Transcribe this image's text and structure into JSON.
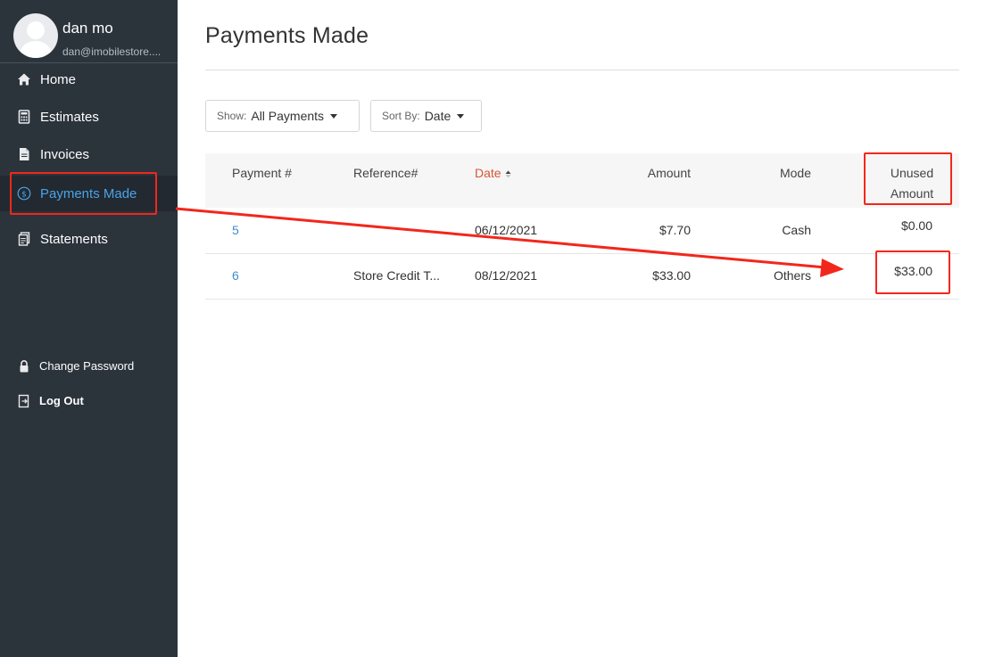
{
  "profile": {
    "name": "dan mo",
    "email": "dan@imobilestore...."
  },
  "nav": {
    "items": [
      {
        "label": "Home",
        "icon": "home-icon"
      },
      {
        "label": "Estimates",
        "icon": "calculator-icon"
      },
      {
        "label": "Invoices",
        "icon": "document-icon"
      },
      {
        "label": "Payments Made",
        "icon": "dollar-circle-icon",
        "active": true
      },
      {
        "label": "Statements",
        "icon": "statements-icon"
      }
    ],
    "secondary": [
      {
        "label": "Change Password",
        "icon": "lock-icon"
      },
      {
        "label": "Log Out",
        "icon": "logout-icon"
      }
    ]
  },
  "page": {
    "title": "Payments Made"
  },
  "filters": {
    "show": {
      "label": "Show:",
      "value": "All Payments"
    },
    "sort": {
      "label": "Sort By:",
      "value": "Date"
    }
  },
  "table": {
    "headers": {
      "payment": "Payment #",
      "reference": "Reference#",
      "date": "Date",
      "amount": "Amount",
      "mode": "Mode",
      "unused_line1": "Unused",
      "unused_line2": "Amount"
    },
    "sorted_column": "Date",
    "rows": [
      {
        "payment": "5",
        "reference": "",
        "date": "06/12/2021",
        "amount": "$7.70",
        "mode": "Cash",
        "unused": "$0.00"
      },
      {
        "payment": "6",
        "reference": "Store Credit T...",
        "date": "08/12/2021",
        "amount": "$33.00",
        "mode": "Others",
        "unused": "$33.00"
      }
    ]
  },
  "colors": {
    "sidebar_bg": "#2b333b",
    "active_text": "#4aa3e8",
    "sorted_header": "#d55734",
    "link": "#3c8ecf",
    "annotation": "#f2271c"
  }
}
